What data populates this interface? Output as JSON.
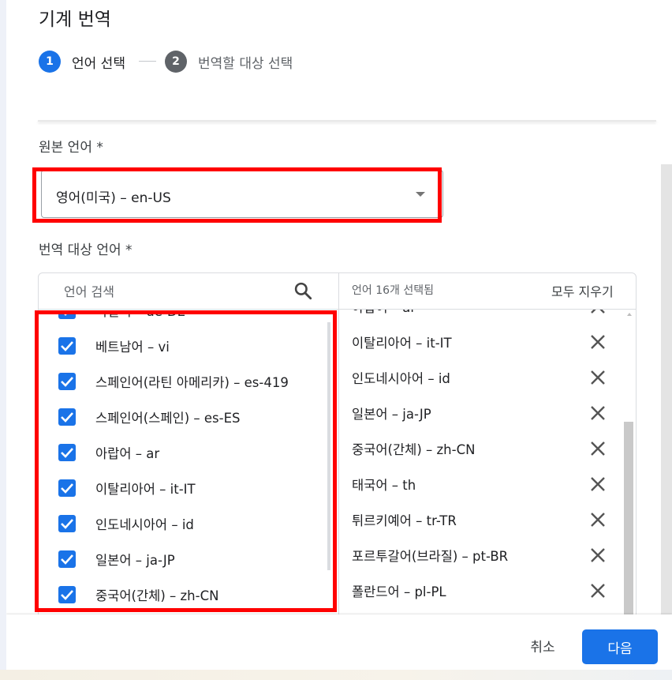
{
  "dialog": {
    "title": "기계 번역"
  },
  "stepper": {
    "steps": [
      {
        "number": "1",
        "label": "언어 선택",
        "state": "active",
        "color": "#1a73e8"
      },
      {
        "number": "2",
        "label": "번역할 대상 선택",
        "state": "inactive",
        "color": "#5f6368"
      }
    ]
  },
  "source": {
    "label": "원본 언어 *",
    "selected": "영어(미국) – en-US",
    "dropdown_icon": "caret-down-icon"
  },
  "target": {
    "label": "번역 대상 언어 *",
    "search_placeholder": "언어 검색",
    "search_icon": "search-icon",
    "available": [
      {
        "label": "독일어 – de-DE",
        "checked": true
      },
      {
        "label": "베트남어 – vi",
        "checked": true
      },
      {
        "label": "스페인어(라틴 아메리카) – es-419",
        "checked": true
      },
      {
        "label": "스페인어(스페인) – es-ES",
        "checked": true
      },
      {
        "label": "아랍어 – ar",
        "checked": true
      },
      {
        "label": "이탈리아어 – it-IT",
        "checked": true
      },
      {
        "label": "인도네시아어 – id",
        "checked": true
      },
      {
        "label": "일본어 – ja-JP",
        "checked": true
      },
      {
        "label": "중국어(간체) – zh-CN",
        "checked": true
      }
    ],
    "selected_count_text": "언어 16개 선택됨",
    "clear_all": "모두 지우기",
    "selected": [
      {
        "label": "아랍어 – ar"
      },
      {
        "label": "이탈리아어 – it-IT"
      },
      {
        "label": "인도네시아어 – id"
      },
      {
        "label": "일본어 – ja-JP"
      },
      {
        "label": "중국어(간체) – zh-CN"
      },
      {
        "label": "태국어 – th"
      },
      {
        "label": "튀르키예어 – tr-TR"
      },
      {
        "label": "포르투갈어(브라질) – pt-BR"
      },
      {
        "label": "폴란드어 – pl-PL"
      }
    ]
  },
  "footer": {
    "cancel": "취소",
    "next": "다음"
  },
  "colors": {
    "primary": "#1a73e8",
    "highlight": "#ff0000"
  }
}
